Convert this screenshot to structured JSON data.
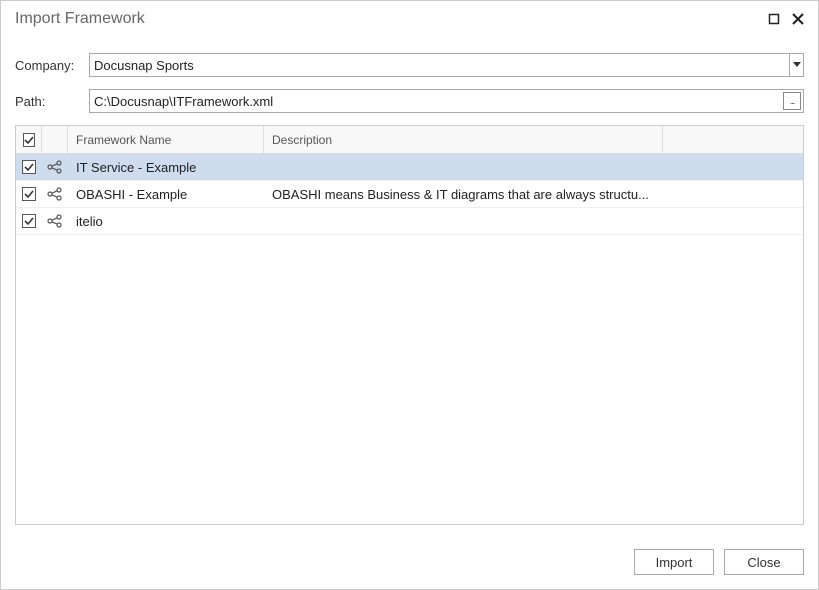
{
  "window": {
    "title": "Import Framework"
  },
  "form": {
    "company_label": "Company:",
    "company_value": "Docusnap Sports",
    "path_label": "Path:",
    "path_value": "C:\\Docusnap\\ITFramework.xml"
  },
  "grid": {
    "header_check": true,
    "columns": {
      "name": "Framework Name",
      "description": "Description"
    },
    "rows": [
      {
        "checked": true,
        "name": "IT Service - Example",
        "description": "",
        "selected": true
      },
      {
        "checked": true,
        "name": "OBASHI - Example",
        "description": "OBASHI means Business & IT diagrams that are always structu...",
        "selected": false
      },
      {
        "checked": true,
        "name": "itelio",
        "description": "",
        "selected": false
      }
    ]
  },
  "buttons": {
    "import": "Import",
    "close": "Close"
  }
}
